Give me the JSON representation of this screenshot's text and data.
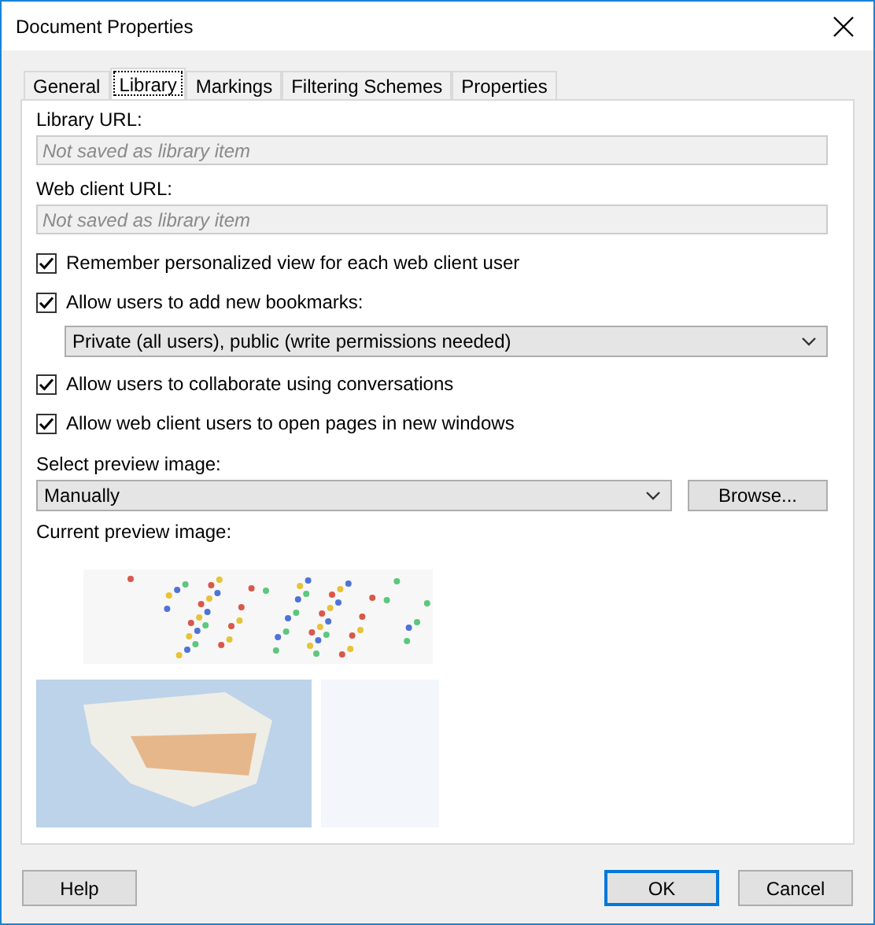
{
  "window": {
    "title": "Document Properties"
  },
  "tabs": [
    {
      "label": "General",
      "selected": false
    },
    {
      "label": "Library",
      "selected": true
    },
    {
      "label": "Markings",
      "selected": false
    },
    {
      "label": "Filtering Schemes",
      "selected": false
    },
    {
      "label": "Properties",
      "selected": false
    }
  ],
  "fields": [
    {
      "label": "Library URL:",
      "placeholder": "Not saved as library item",
      "disabled": true
    },
    {
      "label": "Web client URL:",
      "placeholder": "Not saved as library item",
      "disabled": true
    }
  ],
  "options": [
    {
      "kind": "checkbox",
      "label": "Remember personalized view for each web client user",
      "checked": true
    },
    {
      "kind": "checkbox",
      "label": "Allow users to add new bookmarks:",
      "checked": true
    },
    {
      "kind": "dropdown",
      "value": "Private (all users), public (write permissions needed)"
    },
    {
      "kind": "checkbox",
      "label": "Allow users to collaborate using conversations",
      "checked": true
    },
    {
      "kind": "checkbox",
      "label": "Allow web client users to open pages in new windows",
      "checked": true
    }
  ],
  "preview_select": {
    "label": "Select preview image:",
    "value": "Manually",
    "button": "Browse..."
  },
  "current_preview": {
    "label": "Current preview image:"
  },
  "buttons": [
    {
      "label": "Help",
      "default": false
    },
    {
      "label": "OK",
      "default": true
    },
    {
      "label": "Cancel",
      "default": false
    }
  ]
}
